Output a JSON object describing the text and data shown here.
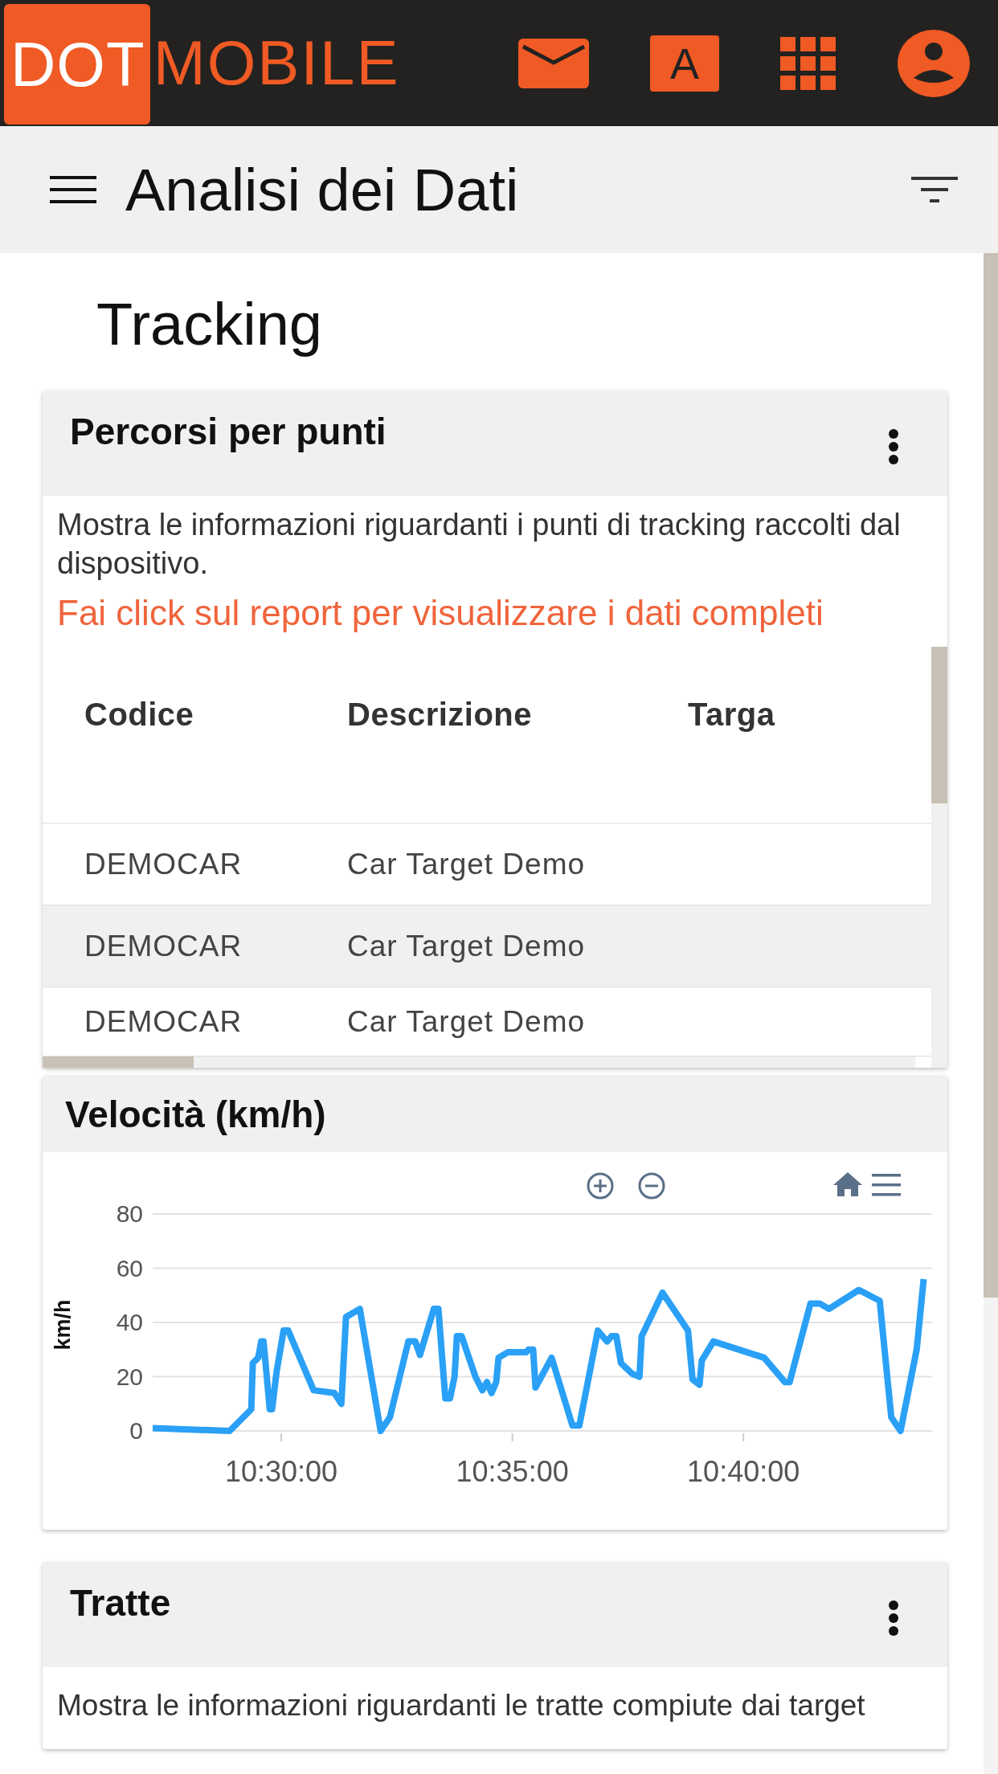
{
  "app_bar": {
    "logo": {
      "part_1": "DOT",
      "part_2": "MOBILE"
    },
    "letter_button": "A"
  },
  "toolbar": {
    "title": "Analisi dei Dati"
  },
  "page_title": "Tracking",
  "cards": [
    {
      "kind": "table",
      "title": "Percorsi per punti",
      "has_menu": true,
      "description": "Mostra le informazioni riguardanti i punti di tracking raccolti dal dispositivo.",
      "link": "Fai click sul report per visualizzare i dati completi",
      "table": {
        "columns": [
          "Codice",
          "Descrizione",
          "Targa"
        ],
        "rows": [
          {
            "codice": "DEMOCAR",
            "descrizione": "Car Target Demo"
          },
          {
            "codice": "DEMOCAR",
            "descrizione": "Car Target Demo"
          },
          {
            "codice": "DEMOCAR",
            "descrizione": "Car Target Demo"
          }
        ]
      }
    },
    {
      "kind": "chart",
      "title": "Velocità (km/h)",
      "has_menu": false,
      "chart_data": {
        "type": "line",
        "grid": true,
        "ylabel": "km/h",
        "xlim": [
          37633,
          38645
        ],
        "ylim": [
          0,
          80
        ],
        "yticks": [
          0,
          20,
          40,
          60,
          80
        ],
        "xticks": [
          {
            "value": 37800,
            "label": "10:30:00"
          },
          {
            "value": 38100,
            "label": "10:35:00"
          },
          {
            "value": 38400,
            "label": "10:40:00"
          }
        ],
        "x": [
          37633,
          37733,
          37761,
          37763,
          37770,
          37774,
          37777,
          37785,
          37788,
          37794,
          37803,
          37809,
          37842,
          37869,
          37878,
          37884,
          37902,
          37929,
          37941,
          37965,
          37974,
          37980,
          37998,
          38004,
          38013,
          38019,
          38025,
          38028,
          38034,
          38052,
          38061,
          38067,
          38073,
          38079,
          38082,
          38094,
          38118,
          38121,
          38127,
          38130,
          38151,
          38178,
          38187,
          38211,
          38223,
          38229,
          38235,
          38241,
          38256,
          38265,
          38268,
          38295,
          38328,
          38334,
          38343,
          38346,
          38361,
          38427,
          38454,
          38460,
          38487,
          38499,
          38511,
          38550,
          38577,
          38592,
          38604,
          38625,
          38634
        ],
        "series": [
          {
            "color": "#2aa0f6",
            "values": [
              1,
              0,
              8,
              25,
              27,
              33,
              33,
              8,
              8,
              22,
              37,
              37,
              15,
              14,
              10,
              42,
              45,
              0,
              5,
              33,
              33,
              28,
              45,
              45,
              12,
              12,
              20,
              35,
              35,
              20,
              15,
              18,
              14,
              18,
              27,
              29,
              29,
              30,
              30,
              16,
              27,
              2,
              2,
              37,
              33,
              35,
              35,
              25,
              21,
              20,
              35,
              51,
              37,
              19,
              17,
              26,
              33,
              27,
              18,
              18,
              47,
              47,
              45,
              52,
              48,
              5,
              0,
              30,
              56
            ]
          }
        ]
      }
    },
    {
      "kind": "text",
      "title": "Tratte",
      "has_menu": true,
      "description": "Mostra le informazioni riguardanti le tratte compiute dai target"
    }
  ]
}
